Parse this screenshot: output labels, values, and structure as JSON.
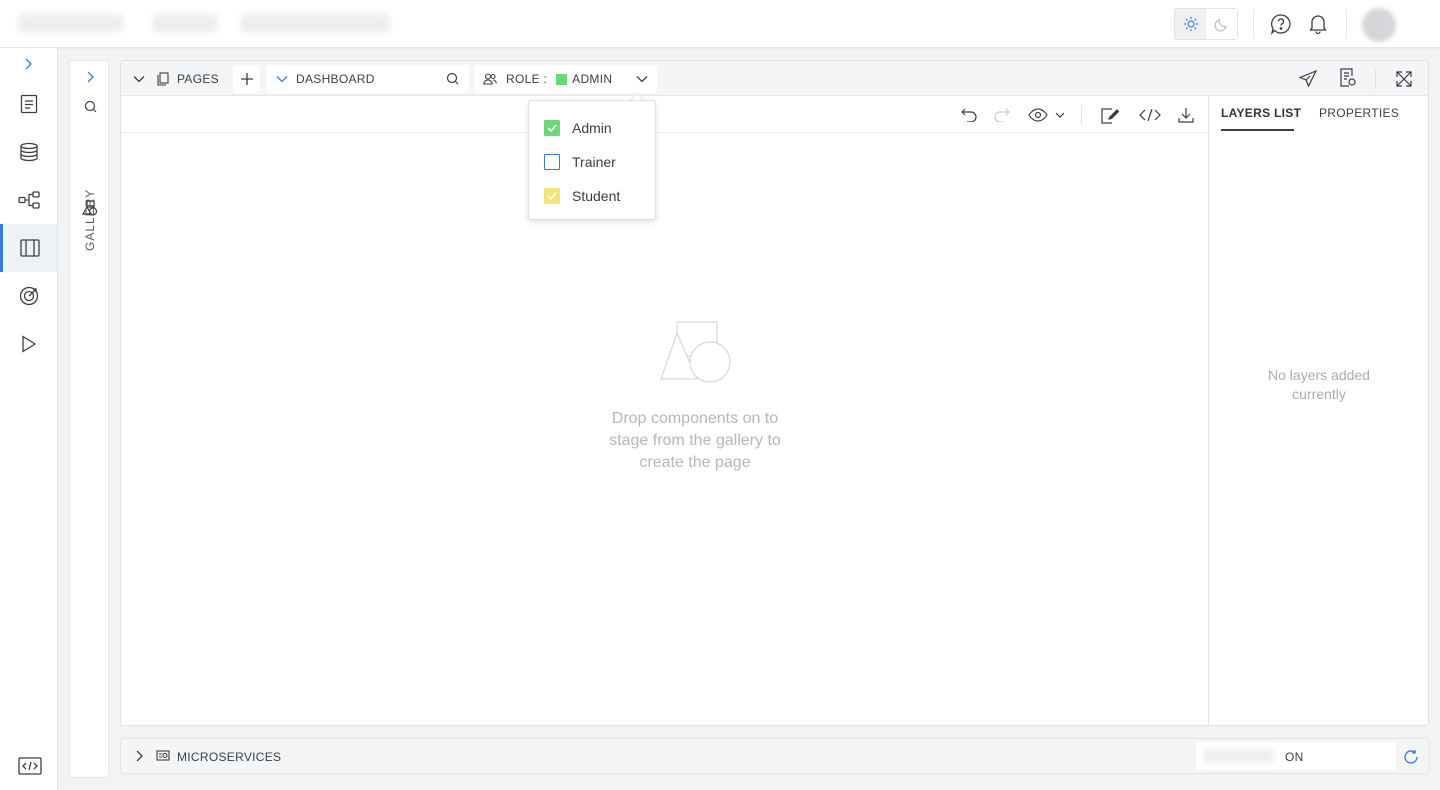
{
  "topbar": {
    "theme": {
      "light_icon": "sun-icon",
      "dark_icon": "moon-icon",
      "active": "light"
    },
    "help_icon": "help-icon",
    "notifications_icon": "bell-icon"
  },
  "leftnav": {
    "items": [
      {
        "name": "document-icon"
      },
      {
        "name": "database-icon"
      },
      {
        "name": "workflow-icon"
      },
      {
        "name": "page-builder-icon",
        "active": true
      },
      {
        "name": "target-icon"
      },
      {
        "name": "play-icon"
      }
    ],
    "bottom_icon": "code-icon"
  },
  "gallery": {
    "label": "GALLERY"
  },
  "pages": {
    "label": "PAGES",
    "current_page": "DASHBOARD",
    "role_label": "ROLE :",
    "role_value": "ADMIN",
    "role_color": "#6cd67a"
  },
  "role_dropdown": {
    "options": [
      {
        "label": "Admin",
        "checked": true,
        "color": "#6cd67a"
      },
      {
        "label": "Trainer",
        "checked": false,
        "color": "#3a7bd5"
      },
      {
        "label": "Student",
        "checked": true,
        "color": "#f3e57a"
      }
    ]
  },
  "canvas": {
    "empty_message": "Drop components on to stage from the gallery to create the page"
  },
  "right_panel": {
    "tabs": [
      {
        "label": "LAYERS LIST",
        "active": true
      },
      {
        "label": "PROPERTIES",
        "active": false
      }
    ],
    "empty_message": "No layers added currently"
  },
  "bottom": {
    "label": "MICROSERVICES",
    "status": "ON"
  },
  "colors": {
    "accent": "#3a7bd5",
    "muted_text": "#b4b8bc"
  }
}
